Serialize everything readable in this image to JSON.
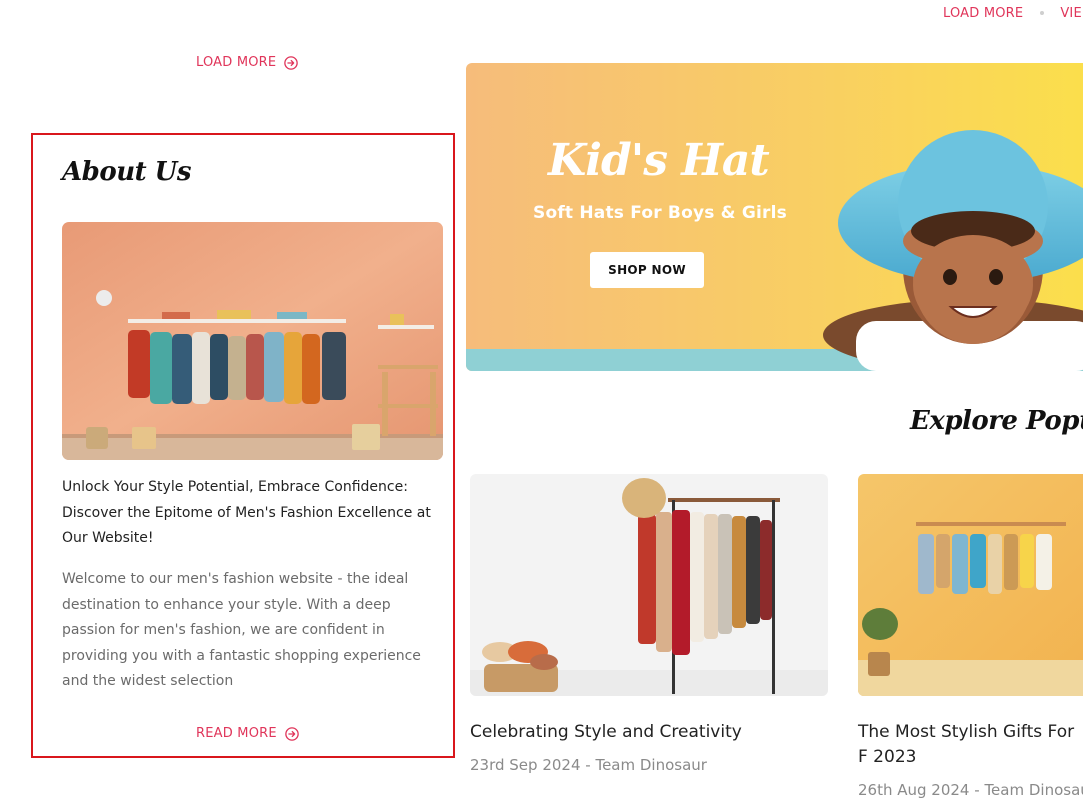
{
  "top_links": {
    "load_more": "LOAD MORE",
    "view": "VIE"
  },
  "left_load_more": "LOAD MORE",
  "about": {
    "title": "About Us",
    "headline": "Unlock Your Style Potential, Embrace Confidence: Discover the Epitome of Men's Fashion Excellence at Our Website!",
    "body": "Welcome to our men's fashion website - the ideal destination to enhance your style. With a deep passion for men's fashion, we are confident in providing you with a fantastic shopping experience and the widest selection",
    "read_more": "READ MORE"
  },
  "banner": {
    "title": "Kid's Hat",
    "subtitle": "Soft Hats For Boys & Girls",
    "button": "SHOP NOW"
  },
  "explore": {
    "title": "Explore Popular"
  },
  "posts": [
    {
      "title": "Celebrating Style and Creativity",
      "date": "23rd Sep 2024",
      "author": "- Team Dinosaur"
    },
    {
      "title": "The Most Stylish Gifts For F 2023",
      "date": "26th Aug 2024",
      "author": "- Team Dinosau"
    }
  ],
  "colors": {
    "accent": "#e0355a",
    "card_border": "#d9171c"
  },
  "icons": [
    "circle-arrow-right-icon"
  ]
}
